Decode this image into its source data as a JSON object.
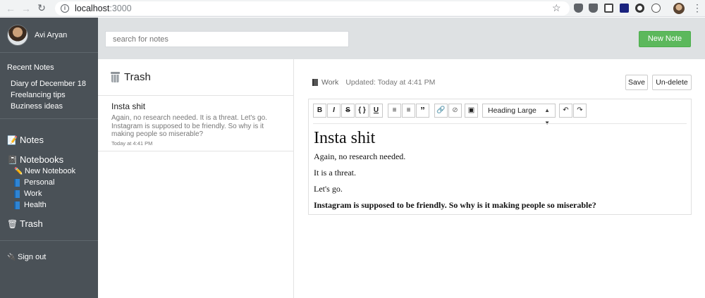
{
  "browser": {
    "url_host": "localhost",
    "url_port": ":3000"
  },
  "user": {
    "name": "Avi Aryan"
  },
  "sidebar": {
    "recent_title": "Recent Notes",
    "recent_items": [
      "Diary of December 18",
      "Freelancing tips",
      "Buziness ideas"
    ],
    "notes_label": "Notes",
    "notebooks_label": "Notebooks",
    "new_notebook_label": "New Notebook",
    "notebooks": [
      "Personal",
      "Work",
      "Health"
    ],
    "trash_label": "Trash",
    "sign_out_label": "Sign out"
  },
  "topbar": {
    "search_placeholder": "search for notes",
    "new_note_label": "New Note"
  },
  "list": {
    "title": "Trash",
    "notes": [
      {
        "title": "Insta shit",
        "excerpt": "Again, no research needed. It is a threat. Let's go. Instagram is supposed to be friendly. So why is it making people so miserable?",
        "date": "Today at 4:41 PM"
      }
    ]
  },
  "editor": {
    "notebook": "Work",
    "updated": "Updated: Today at 4:41 PM",
    "save_label": "Save",
    "undelete_label": "Un-delete",
    "toolbar": {
      "bold": "B",
      "italic": "I",
      "strike": "S",
      "code": "{ }",
      "underline": "U",
      "heading_select": "Heading Large"
    },
    "content": {
      "heading": "Insta shit",
      "paragraphs": [
        "Again, no research needed.",
        "It is a threat.",
        "Let's go."
      ],
      "bold_paragraph": "Instagram is supposed to be friendly. So why is it making people so miserable?"
    }
  },
  "colors": {
    "sidebar_bg": "#4a5157",
    "topbar_bg": "#dee1e3",
    "new_note_green": "#5cb85c"
  }
}
